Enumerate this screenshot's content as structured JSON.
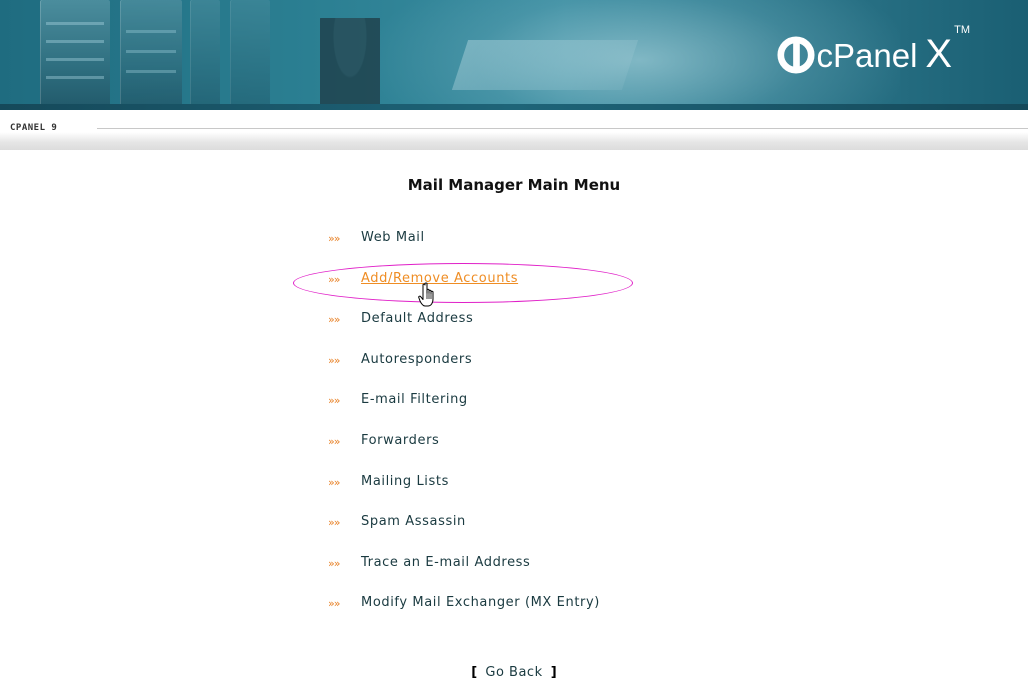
{
  "banner": {
    "logo_text": "cPanel",
    "logo_x": "X",
    "logo_tm": "TM"
  },
  "version_label": "CPANEL 9",
  "page_title": "Mail Manager Main Menu",
  "bullet_glyph": "»»",
  "accent_color": "#ef8d24",
  "highlight_color": "#e020c8",
  "menu": {
    "items": [
      {
        "label": "Web Mail"
      },
      {
        "label": "Add/Remove Accounts",
        "active": true
      },
      {
        "label": "Default Address"
      },
      {
        "label": "Autoresponders"
      },
      {
        "label": "E-mail Filtering"
      },
      {
        "label": "Forwarders"
      },
      {
        "label": "Mailing Lists"
      },
      {
        "label": "Spam Assassin"
      },
      {
        "label": "Trace an E-mail Address"
      },
      {
        "label": "Modify Mail Exchanger (MX Entry)"
      }
    ]
  },
  "footer": {
    "open_bracket": "[",
    "go_back_label": "Go Back",
    "close_bracket": "]"
  }
}
